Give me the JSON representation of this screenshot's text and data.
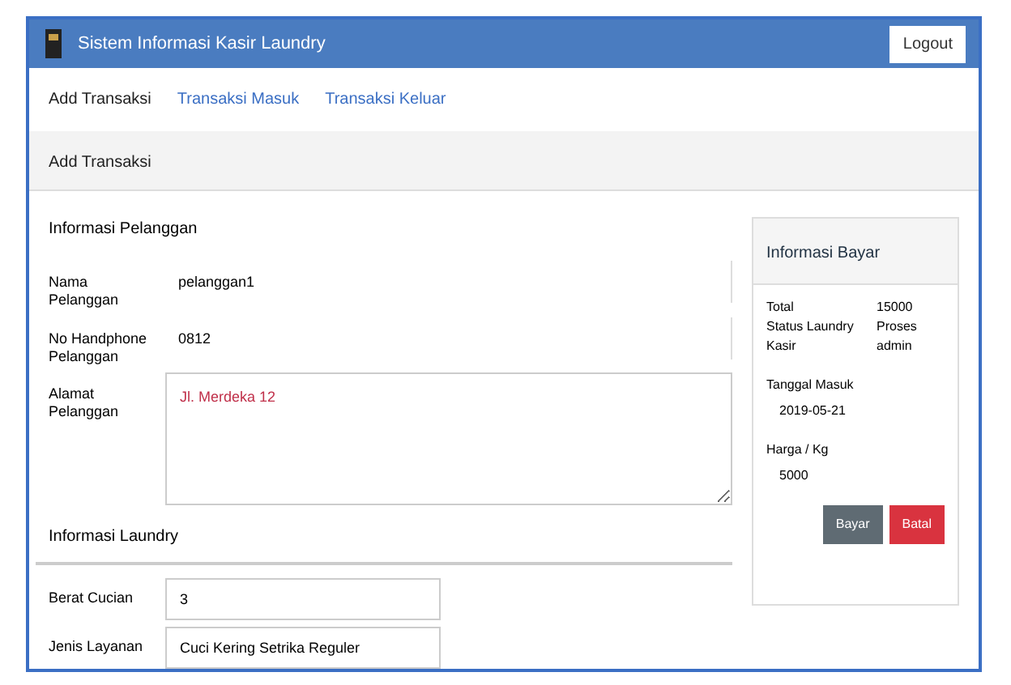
{
  "navbar": {
    "title": "Sistem Informasi Kasir Laundry",
    "button": "Logout"
  },
  "breadcrumb": [
    {
      "label": "Add Transaksi",
      "selected": true
    },
    {
      "label": "Transaksi Masuk",
      "selected": false
    },
    {
      "label": "Transaksi Keluar",
      "selected": false
    }
  ],
  "page_title": "Add Transaksi",
  "customer": {
    "title": "Informasi Pelanggan",
    "fields": [
      {
        "kind": "input",
        "label": "Nama Pelanggan",
        "value": "pelanggan1"
      },
      {
        "kind": "input",
        "label": "No Handphone Pelanggan",
        "value": "0812"
      },
      {
        "kind": "textarea",
        "label": "Alamat Pelanggan",
        "value": "Jl. Merdeka 12"
      }
    ]
  },
  "laundry": {
    "title": "Informasi Laundry",
    "fields": [
      {
        "label": "Berat Cucian",
        "value": "3"
      },
      {
        "label": "Jenis Layanan",
        "value": "Cuci Kering Setrika Reguler"
      }
    ]
  },
  "payment": {
    "title": "Informasi Bayar",
    "rows": [
      {
        "label": "Total",
        "value": "15000"
      },
      {
        "label": "Status Laundry",
        "value": "Proses"
      },
      {
        "label": "Kasir",
        "value": "admin"
      }
    ],
    "blocks": [
      {
        "label": "Tanggal Masuk",
        "value": "2019-05-21"
      },
      {
        "label": "Harga / Kg",
        "value": "5000"
      }
    ],
    "buttons": [
      {
        "kind": "secondary",
        "label": "Bayar"
      },
      {
        "kind": "danger",
        "label": "Batal"
      }
    ]
  }
}
